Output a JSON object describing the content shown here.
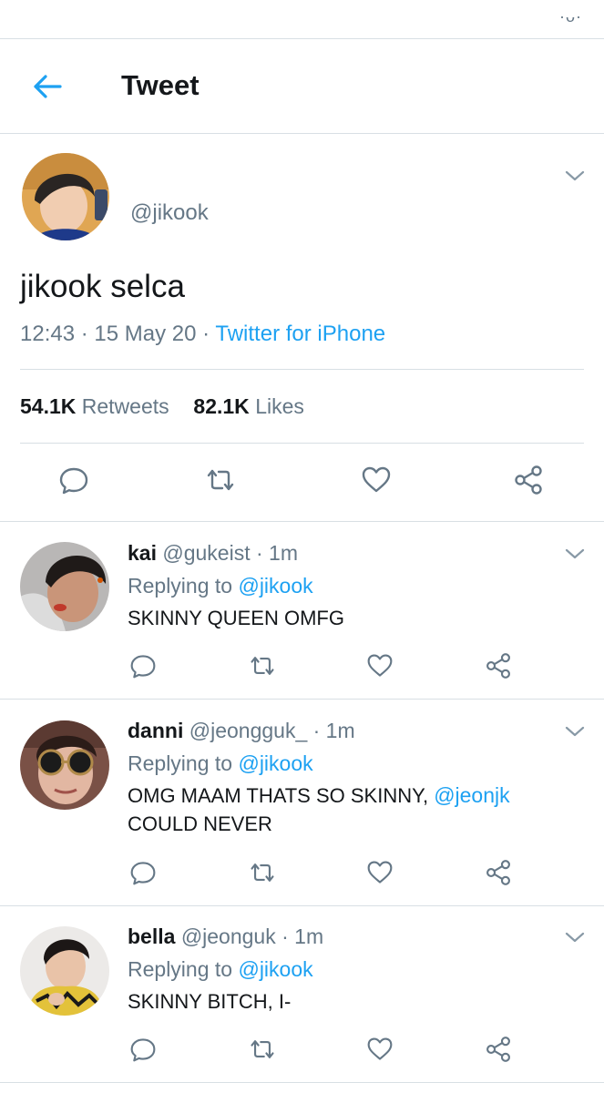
{
  "status_bar": {
    "deco": "·ᴗ·"
  },
  "header": {
    "title": "Tweet"
  },
  "main_tweet": {
    "handle": "@jikook",
    "text": "jikook selca",
    "time": "12:43",
    "date": "15 May 20",
    "separator": "·",
    "source": "Twitter for iPhone",
    "retweets_count": "54.1K",
    "retweets_label": "Retweets",
    "likes_count": "82.1K",
    "likes_label": "Likes"
  },
  "replies": [
    {
      "name": "kai",
      "handle": "@gukeist",
      "time": "· 1m",
      "replying_label": "Replying to",
      "replying_to": "@jikook",
      "text": "SKINNY QUEEN OMFG"
    },
    {
      "name": "danni",
      "handle": "@jeongguk_",
      "time": "· 1m",
      "replying_label": "Replying to",
      "replying_to": "@jikook",
      "text_part1": "OMG MAAM THATS SO SKINNY,",
      "mention": "@jeonjk",
      "text_part2": "COULD NEVER"
    },
    {
      "name": "bella",
      "handle": "@jeonguk",
      "time": "· 1m",
      "replying_label": "Replying to",
      "replying_to": "@jikook",
      "text": "SKINNY BITCH, I-"
    }
  ],
  "colors": {
    "accent": "#1da1f2",
    "muted": "#657786",
    "text": "#14171a",
    "divider": "#d8dfe4"
  },
  "icons": [
    "back-arrow-icon",
    "chevron-down-icon",
    "reply-icon",
    "retweet-icon",
    "like-icon",
    "share-icon"
  ]
}
